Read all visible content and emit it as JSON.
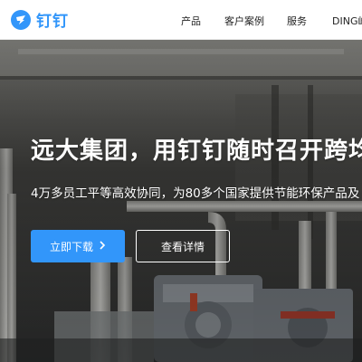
{
  "brand": {
    "name": "钉钉",
    "color": "#3296fa",
    "logo_icon": "dingtalk-logo-icon"
  },
  "nav": {
    "items": [
      {
        "label": "产品"
      },
      {
        "label": "客户案例"
      },
      {
        "label": "服务"
      },
      {
        "label": "DING峰"
      }
    ]
  },
  "hero": {
    "title": "远大集团，用钉钉随时召开跨均",
    "subtitle": "4万多员工平等高效协同，为80多个国家提供节能环保产品及",
    "primary_button": "立即下载",
    "primary_button_icon": "chevron-right-icon",
    "secondary_button": "查看详情"
  }
}
